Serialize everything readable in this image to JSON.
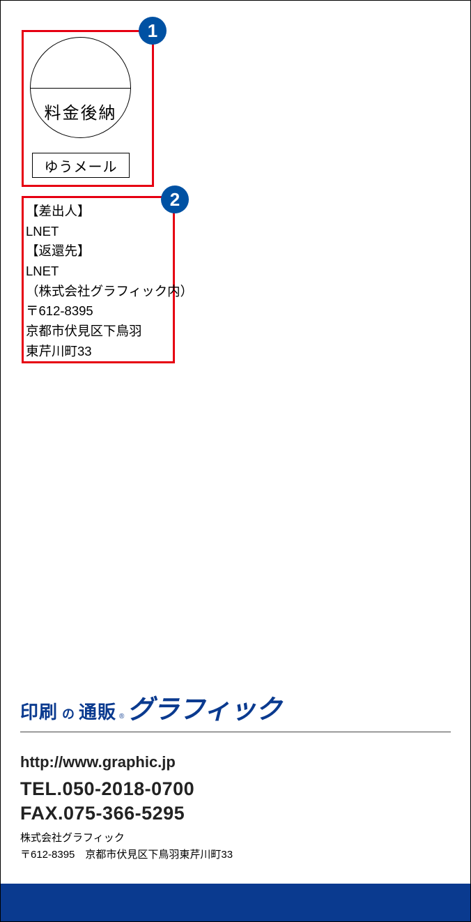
{
  "annotations": {
    "badge1": "1",
    "badge2": "2"
  },
  "postage": {
    "circle_text": "料金後納",
    "mail_type": "ゆうメール"
  },
  "sender": {
    "label_sender": "【差出人】",
    "sender_name": "LNET",
    "label_return": "【返還先】",
    "return_name": "LNET",
    "return_co": "（株式会社グラフィック内）",
    "postal": "〒612-8395",
    "addr1": "京都市伏見区下鳥羽",
    "addr2": "東芹川町33"
  },
  "footer": {
    "logo_small": "印刷",
    "logo_no": "の",
    "logo_tsuhan": "通販",
    "logo_r": "®",
    "logo_big": "グラフィック",
    "url": "http://www.graphic.jp",
    "tel": "TEL.050-2018-0700",
    "fax": "FAX.075-366-5295",
    "company_name": "株式会社グラフィック",
    "company_addr": "〒612-8395　京都市伏見区下鳥羽東芹川町33"
  }
}
